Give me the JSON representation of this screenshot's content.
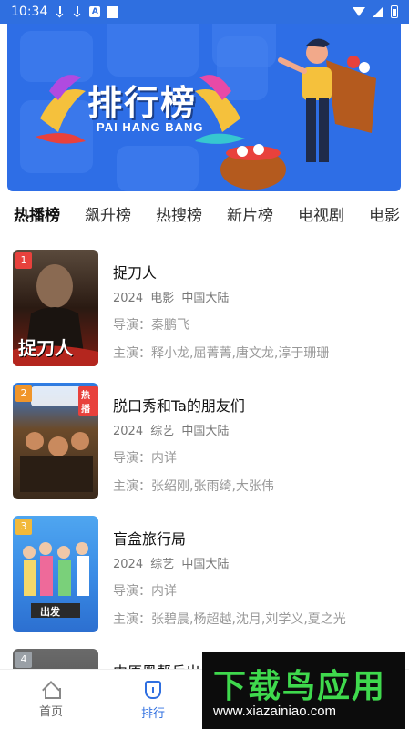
{
  "status_bar": {
    "time": "10:34"
  },
  "banner": {
    "title": "排行榜",
    "subtitle": "PAI HANG BANG"
  },
  "tabs": [
    {
      "label": "热播榜",
      "active": true
    },
    {
      "label": "飙升榜",
      "active": false
    },
    {
      "label": "热搜榜",
      "active": false
    },
    {
      "label": "新片榜",
      "active": false
    },
    {
      "label": "电视剧",
      "active": false
    },
    {
      "label": "电影",
      "active": false
    }
  ],
  "items": [
    {
      "rank": "1",
      "rank_color": "#e8413c",
      "title": "捉刀人",
      "meta": "2024  电影  中国大陆",
      "director": "导演：秦鹏飞",
      "cast": "主演：释小龙,屈菁菁,唐文龙,淳于珊珊",
      "poster_text": "捉刀人"
    },
    {
      "rank": "2",
      "rank_color": "#f0952a",
      "title": "脱口秀和Ta的朋友们",
      "meta": "2024  综艺  中国大陆",
      "director": "导演：内详",
      "cast": "主演：张绍刚,张雨绮,大张伟",
      "poster_text": "热播"
    },
    {
      "rank": "3",
      "rank_color": "#f2b93b",
      "title": "盲盒旅行局",
      "meta": "2024  综艺  中国大陆",
      "director": "导演：内详",
      "cast": "主演：张碧晨,杨超越,沈月,刘学义,夏之光",
      "poster_text": "出发"
    },
    {
      "rank": "4",
      "rank_color": "#9aa0a6",
      "title": "中原黑帮兵出",
      "meta": "",
      "director": "",
      "cast": "",
      "poster_text": ""
    }
  ],
  "bottom_nav": [
    {
      "label": "首页",
      "icon": "home-icon",
      "active": false
    },
    {
      "label": "排行",
      "icon": "rank-icon",
      "active": true
    }
  ],
  "watermark": {
    "title": "下载鸟应用",
    "url": "www.xiazainiao.com"
  }
}
